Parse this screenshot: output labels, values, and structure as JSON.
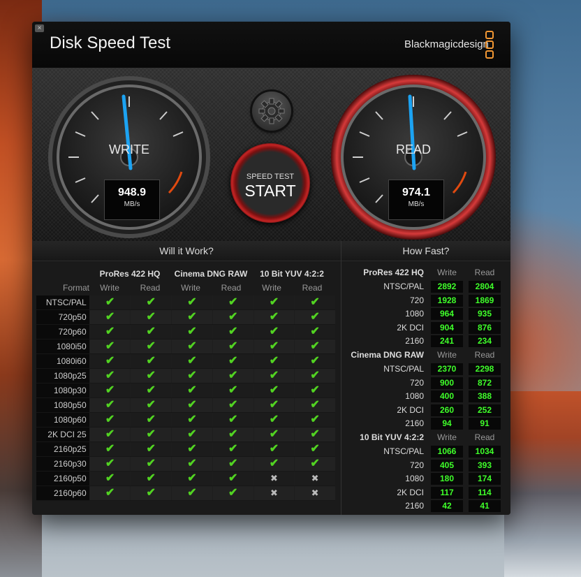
{
  "app": {
    "title": "Disk Speed Test",
    "brand": "Blackmagicdesign",
    "close_glyph": "×"
  },
  "colors": {
    "accent": "#f29733",
    "needle": "#1ca3f2",
    "value_green": "#3fff2a",
    "check": "#52d322",
    "read_ring": "#c42424"
  },
  "icons": {
    "close": "close-icon",
    "gear": "gear-icon",
    "check": "checkmark-icon",
    "cross": "cross-icon"
  },
  "write_gauge": {
    "label": "WRITE",
    "value": "948.9",
    "unit": "MB/s"
  },
  "read_gauge": {
    "label": "READ",
    "value": "974.1",
    "unit": "MB/s"
  },
  "start_button": {
    "small": "SPEED TEST",
    "big": "START"
  },
  "will_it_work": {
    "heading": "Will it Work?",
    "format_label": "Format",
    "codecs": [
      "ProRes 422 HQ",
      "Cinema DNG RAW",
      "10 Bit YUV 4:2:2"
    ],
    "subcols": [
      "Write",
      "Read"
    ],
    "rows": [
      {
        "format": "NTSC/PAL",
        "marks": [
          1,
          1,
          1,
          1,
          1,
          1
        ]
      },
      {
        "format": "720p50",
        "marks": [
          1,
          1,
          1,
          1,
          1,
          1
        ]
      },
      {
        "format": "720p60",
        "marks": [
          1,
          1,
          1,
          1,
          1,
          1
        ]
      },
      {
        "format": "1080i50",
        "marks": [
          1,
          1,
          1,
          1,
          1,
          1
        ]
      },
      {
        "format": "1080i60",
        "marks": [
          1,
          1,
          1,
          1,
          1,
          1
        ]
      },
      {
        "format": "1080p25",
        "marks": [
          1,
          1,
          1,
          1,
          1,
          1
        ]
      },
      {
        "format": "1080p30",
        "marks": [
          1,
          1,
          1,
          1,
          1,
          1
        ]
      },
      {
        "format": "1080p50",
        "marks": [
          1,
          1,
          1,
          1,
          1,
          1
        ]
      },
      {
        "format": "1080p60",
        "marks": [
          1,
          1,
          1,
          1,
          1,
          1
        ]
      },
      {
        "format": "2K DCI 25",
        "marks": [
          1,
          1,
          1,
          1,
          1,
          1
        ]
      },
      {
        "format": "2160p25",
        "marks": [
          1,
          1,
          1,
          1,
          1,
          1
        ]
      },
      {
        "format": "2160p30",
        "marks": [
          1,
          1,
          1,
          1,
          1,
          1
        ]
      },
      {
        "format": "2160p50",
        "marks": [
          1,
          1,
          1,
          1,
          0,
          0
        ]
      },
      {
        "format": "2160p60",
        "marks": [
          1,
          1,
          1,
          1,
          0,
          0
        ]
      }
    ]
  },
  "how_fast": {
    "heading": "How Fast?",
    "subcols": [
      "Write",
      "Read"
    ],
    "groups": [
      {
        "codec": "ProRes 422 HQ",
        "rows": [
          {
            "label": "NTSC/PAL",
            "write": "2892",
            "read": "2804"
          },
          {
            "label": "720",
            "write": "1928",
            "read": "1869"
          },
          {
            "label": "1080",
            "write": "964",
            "read": "935"
          },
          {
            "label": "2K DCI",
            "write": "904",
            "read": "876"
          },
          {
            "label": "2160",
            "write": "241",
            "read": "234"
          }
        ]
      },
      {
        "codec": "Cinema DNG RAW",
        "rows": [
          {
            "label": "NTSC/PAL",
            "write": "2370",
            "read": "2298"
          },
          {
            "label": "720",
            "write": "900",
            "read": "872"
          },
          {
            "label": "1080",
            "write": "400",
            "read": "388"
          },
          {
            "label": "2K DCI",
            "write": "260",
            "read": "252"
          },
          {
            "label": "2160",
            "write": "94",
            "read": "91"
          }
        ]
      },
      {
        "codec": "10 Bit YUV 4:2:2",
        "rows": [
          {
            "label": "NTSC/PAL",
            "write": "1066",
            "read": "1034"
          },
          {
            "label": "720",
            "write": "405",
            "read": "393"
          },
          {
            "label": "1080",
            "write": "180",
            "read": "174"
          },
          {
            "label": "2K DCI",
            "write": "117",
            "read": "114"
          },
          {
            "label": "2160",
            "write": "42",
            "read": "41"
          }
        ]
      }
    ]
  }
}
